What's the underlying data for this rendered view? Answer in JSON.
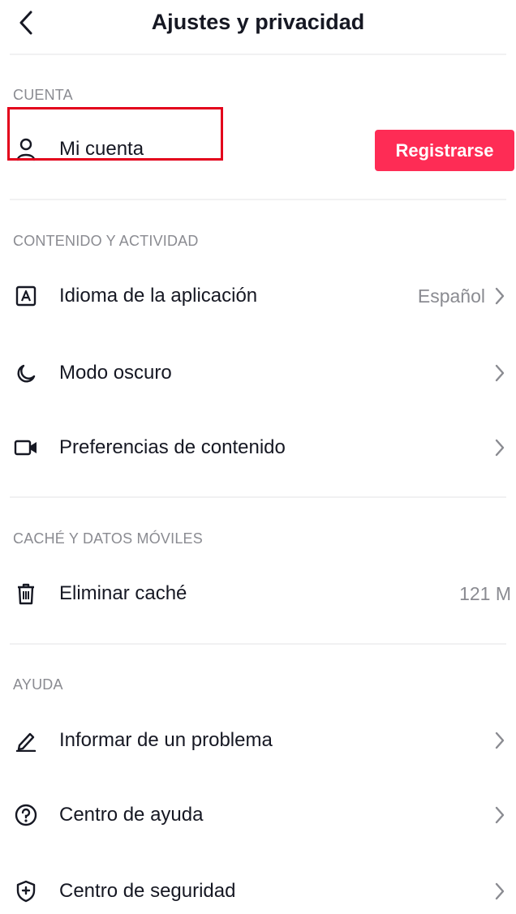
{
  "header": {
    "title": "Ajustes y privacidad",
    "back_icon": "chevron-left-icon"
  },
  "sections": {
    "account": {
      "label": "CUENTA",
      "my_account": {
        "label": "Mi cuenta",
        "icon": "person-icon"
      },
      "signup_label": "Registrarse"
    },
    "content": {
      "label": "CONTENIDO Y ACTIVIDAD",
      "language": {
        "label": "Idioma de la aplicación",
        "value": "Español",
        "icon": "language-a-icon"
      },
      "dark_mode": {
        "label": "Modo oscuro",
        "icon": "moon-icon"
      },
      "preferences": {
        "label": "Preferencias de contenido",
        "icon": "video-camera-icon"
      }
    },
    "cache": {
      "label": "CACHÉ Y DATOS MÓVILES",
      "clear_cache": {
        "label": "Eliminar caché",
        "value": "121 M",
        "icon": "trash-icon"
      }
    },
    "help": {
      "label": "AYUDA",
      "report": {
        "label": "Informar de un problema",
        "icon": "pencil-icon"
      },
      "help_center": {
        "label": "Centro de ayuda",
        "icon": "question-circle-icon"
      },
      "safety_center": {
        "label": "Centro de seguridad",
        "icon": "shield-icon"
      }
    }
  },
  "colors": {
    "accent": "#fe2c55",
    "highlight": "#e3001b",
    "text": "#161823",
    "muted": "#8a8b91",
    "divider": "#f1f1f2"
  }
}
